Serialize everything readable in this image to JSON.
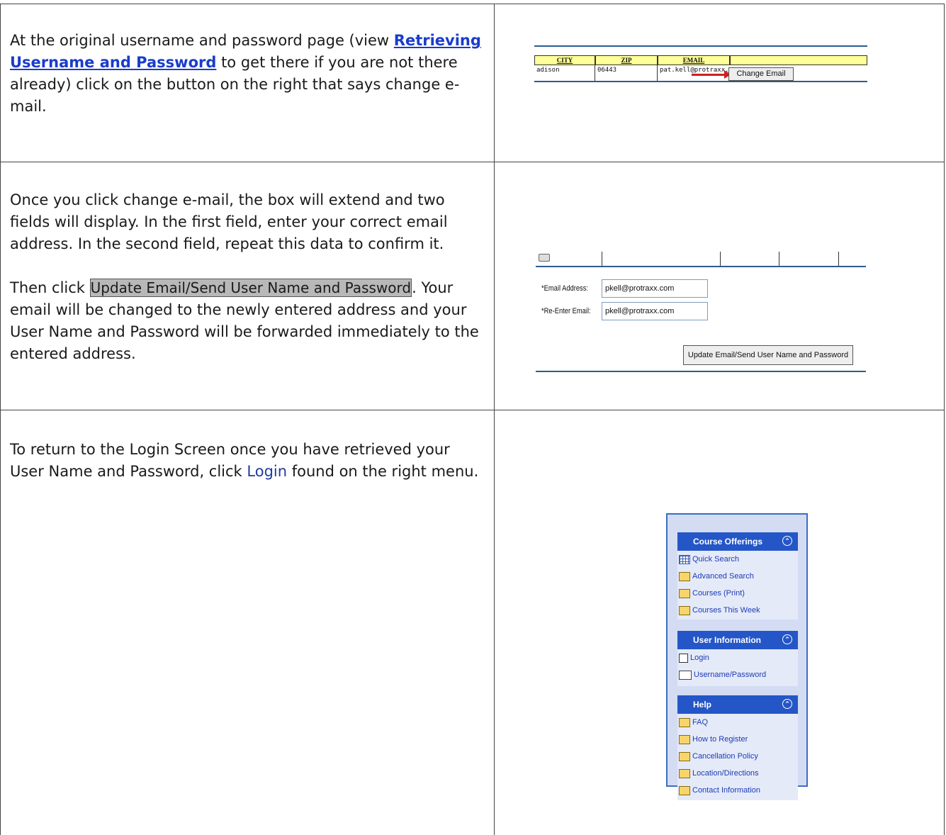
{
  "rows": [
    {
      "text_before_link": "At the original username and password page (view ",
      "link_text": "Retrieving Username and Password",
      "text_after_link": " to get there if you are not there already) click on the button on the right that says change e-mail."
    },
    {
      "para1": "Once you click change e-mail, the box will extend and two fields will display. In the first field, enter your correct email address. In the second field, repeat this data to confirm it.",
      "para2_before": "Then click ",
      "para2_highlight": "Update Email/Send User Name and Password",
      "para2_after": ". Your email will be changed to the newly entered address and your User Name and Password will be forwarded immediately to the entered address."
    },
    {
      "text_before_link": "To return to the Login Screen once you have retrieved your User Name and Password, click ",
      "link_text": "Login",
      "text_after_link": " found on the right menu."
    }
  ],
  "shot1": {
    "headers": [
      "CITY",
      "ZIP",
      "EMAIL"
    ],
    "cells": [
      "adison",
      "06443",
      "pat.kell@protraxx.com"
    ],
    "button": "Change Email"
  },
  "shot2": {
    "email_label": "*Email Address:",
    "email_value": "pkell@protraxx.com",
    "reenter_label": "*Re-Enter Email:",
    "reenter_value": "pkell@protraxx.com",
    "update_button": "Update Email/Send User Name and Password"
  },
  "menu": {
    "sections": [
      {
        "title": "Course Offerings",
        "items": [
          {
            "label": "Quick Search",
            "icon": "calendar-grid-icon"
          },
          {
            "label": "Advanced Search",
            "icon": "folder-search-icon"
          },
          {
            "label": "Courses (Print)",
            "icon": "folder-icon"
          },
          {
            "label": "Courses This Week",
            "icon": "folder-icon"
          }
        ]
      },
      {
        "title": "User Information",
        "items": [
          {
            "label": "Login",
            "icon": "page-icon"
          },
          {
            "label": "Username/Password",
            "icon": "id-card-icon"
          }
        ]
      },
      {
        "title": "Help",
        "items": [
          {
            "label": "FAQ",
            "icon": "folder-icon"
          },
          {
            "label": "How to Register",
            "icon": "folder-icon"
          },
          {
            "label": "Cancellation Policy",
            "icon": "folder-icon"
          },
          {
            "label": "Location/Directions",
            "icon": "folder-icon"
          },
          {
            "label": "Contact Information",
            "icon": "folder-icon"
          }
        ]
      }
    ],
    "collapse_glyph": "«"
  }
}
